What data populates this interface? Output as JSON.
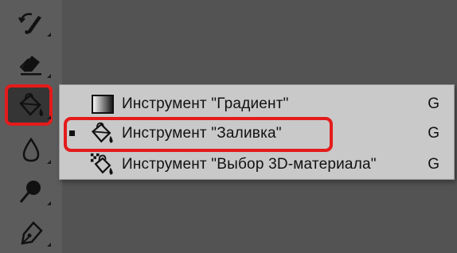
{
  "toolbar": {
    "tools": [
      {
        "name": "history-brush-icon",
        "has_submenu": true
      },
      {
        "name": "eraser-icon",
        "has_submenu": true
      },
      {
        "name": "paint-bucket-icon",
        "has_submenu": true,
        "active": true
      },
      {
        "name": "blur-drop-icon",
        "has_submenu": true
      },
      {
        "name": "dodge-icon",
        "has_submenu": true
      },
      {
        "name": "pen-icon",
        "has_submenu": true
      }
    ]
  },
  "flyout": {
    "items": [
      {
        "label": "Инструмент \"Градиент\"",
        "shortcut": "G",
        "icon": "gradient-icon",
        "selected": false
      },
      {
        "label": "Инструмент \"Заливка\"",
        "shortcut": "G",
        "icon": "paint-bucket-icon",
        "selected": true
      },
      {
        "label": "Инструмент \"Выбор 3D-материала\"",
        "shortcut": "G",
        "icon": "3d-material-drop-icon",
        "selected": false
      }
    ]
  },
  "colors": {
    "highlight": "#e41b1b",
    "menu_bg": "#c9c9c9",
    "toolbar_bg": "#5c5c5c",
    "canvas_bg": "#535353"
  }
}
